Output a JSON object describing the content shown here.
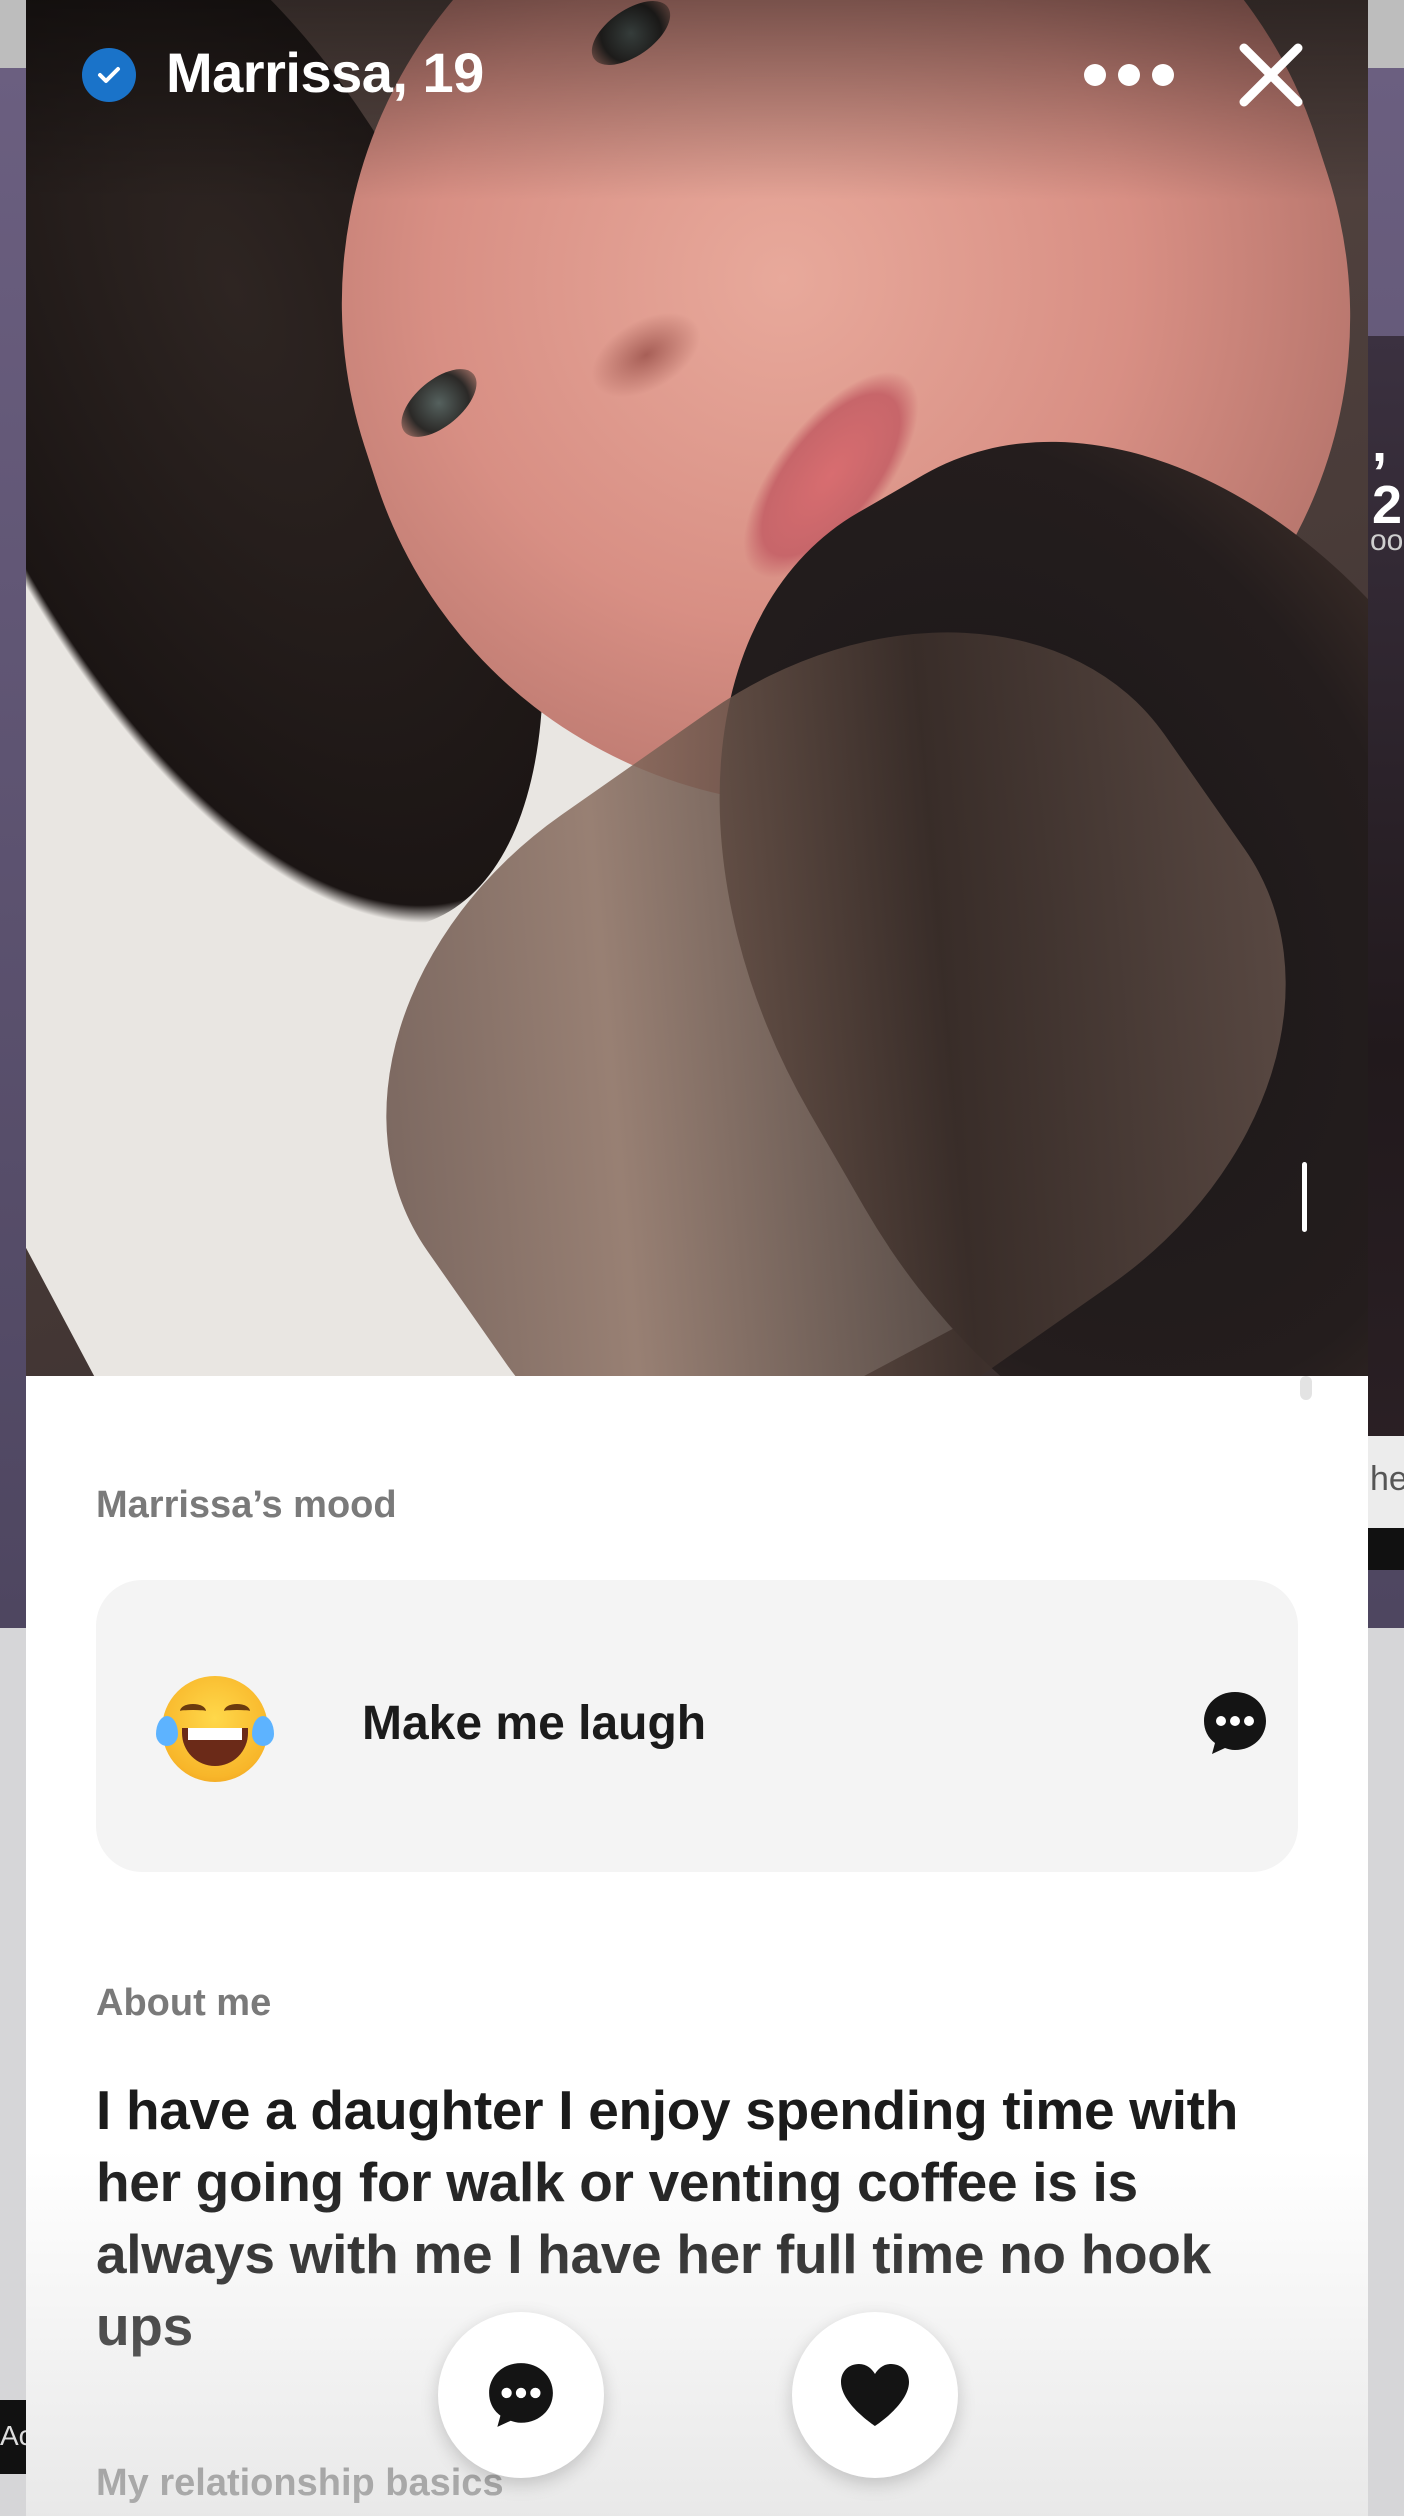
{
  "profile": {
    "name_age": "Marrissa, 19"
  },
  "mood": {
    "label": "Marrissa’s mood",
    "text": "Make me laugh"
  },
  "about": {
    "label": "About me",
    "text": "I have a daughter I enjoy spending time with her going for walk or venting coffee is is always with me I have her full time no hook ups"
  },
  "relationship": {
    "label": "My relationship basics"
  },
  "background": {
    "peek_name": ", 2",
    "peek_sub": "oo",
    "peek_bottom": "he",
    "ad_text": "Ac"
  },
  "icons": {
    "verified": "verified-check-icon",
    "more": "more-dots-icon",
    "close": "close-icon",
    "mood_emoji": "laughing-tears-emoji-icon",
    "mood_chat": "chat-bubble-icon",
    "chat_fab": "chat-bubble-icon",
    "like_fab": "heart-icon"
  },
  "colors": {
    "verified": "#1a73c9",
    "label_gray": "#7a7a7a",
    "text_dark": "#1b1b1b",
    "card_bg": "#f4f4f4"
  }
}
